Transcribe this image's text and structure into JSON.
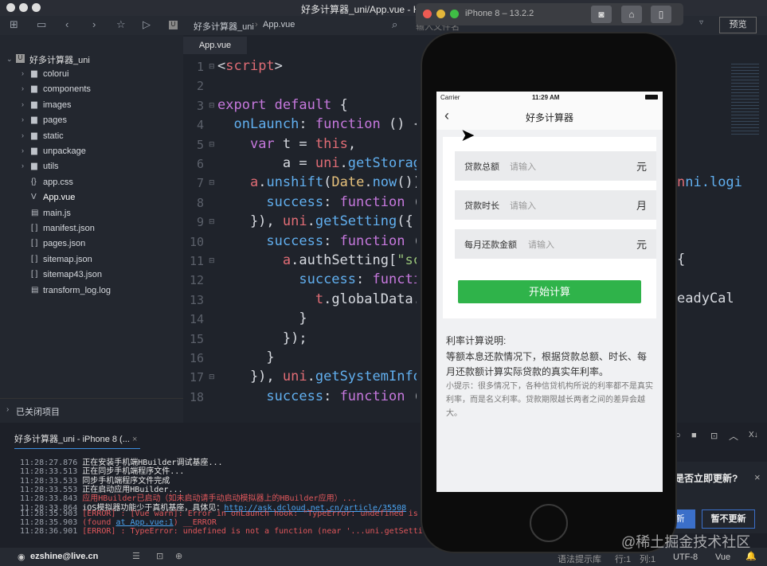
{
  "window": {
    "title": "好多计算器_uni/App.vue - HB"
  },
  "toolbar": {
    "breadcrumb": [
      "好多计算器_uni",
      "App.vue"
    ],
    "file_search_placeholder": "输入文件名",
    "preview_label": "预览"
  },
  "sidebar": {
    "project": "好多计算器_uni",
    "items": [
      {
        "label": "colorui",
        "type": "folder"
      },
      {
        "label": "components",
        "type": "folder"
      },
      {
        "label": "images",
        "type": "folder"
      },
      {
        "label": "pages",
        "type": "folder"
      },
      {
        "label": "static",
        "type": "folder"
      },
      {
        "label": "unpackage",
        "type": "folder"
      },
      {
        "label": "utils",
        "type": "folder"
      },
      {
        "label": "app.css",
        "type": "css"
      },
      {
        "label": "App.vue",
        "type": "vue"
      },
      {
        "label": "main.js",
        "type": "file"
      },
      {
        "label": "manifest.json",
        "type": "json"
      },
      {
        "label": "pages.json",
        "type": "json"
      },
      {
        "label": "sitemap.json",
        "type": "json"
      },
      {
        "label": "sitemap43.json",
        "type": "json"
      },
      {
        "label": "transform_log.log",
        "type": "file"
      }
    ],
    "closed_projects": "已关闭项目"
  },
  "editor": {
    "tab": "App.vue",
    "line_numbers": [
      "1",
      "2",
      "3",
      "4",
      "5",
      "6",
      "7",
      "8",
      "9",
      "10",
      "11",
      "12",
      "13",
      "14",
      "15",
      "16",
      "17",
      "18"
    ],
    "right_fragments": [
      "ni.logi",
      "{",
      "eadyCal"
    ]
  },
  "console": {
    "tab": "好多计算器_uni - iPhone 8 (...",
    "lines": [
      {
        "time": "11:28:27.876",
        "text": "正在安装手机端HBuilder调试基座...",
        "level": "info"
      },
      {
        "time": "11:28:33.513",
        "text": "正在同步手机端程序文件...",
        "level": "info"
      },
      {
        "time": "11:28:33.533",
        "text": "同步手机端程序文件完成",
        "level": "info"
      },
      {
        "time": "11:28:33.553",
        "text": "正在启动应用HBuilder...",
        "level": "info"
      },
      {
        "time": "11:28:33.843",
        "text": "应用HBuilder已启动（如未启动请手动启动模拟器上的HBuilder应用）...",
        "level": "error"
      },
      {
        "time": "11:28:33.864",
        "text": "iOS模拟器功能少于真机基座，具体见：",
        "link": "http://ask.dcloud.net.cn/article/35508",
        "level": "info"
      },
      {
        "time": "11:28:35.903",
        "text": "[ERROR] : [Vue warn]: Error in onLaunch hook: \"TypeError: undefined is no",
        "level": "error"
      },
      {
        "time": "11:28:35.903",
        "text": "(found ",
        "link": "at App.vue:1",
        "after": ") __ERROR",
        "level": "error"
      },
      {
        "time": "11:28:36.901",
        "text": "[ERROR] : TypeError: undefined is not a function (near '...uni.getSetting.",
        "level": "error"
      }
    ]
  },
  "update": {
    "question": "是否立即更新?",
    "confirm": "新",
    "cancel": "暂不更新"
  },
  "statusbar": {
    "user": "ezshine@live.cn",
    "syntax_hint": "语法提示库",
    "row": "行:1",
    "col": "列:1",
    "encoding": "UTF-8",
    "language": "Vue"
  },
  "watermark": "@稀土掘金技术社区",
  "simulator": {
    "title": "iPhone 8 – 13.2.2"
  },
  "phone": {
    "carrier": "Carrier",
    "time": "11:29 AM",
    "nav_title": "好多计算器",
    "fields": [
      {
        "label": "贷款总额",
        "placeholder": "请输入",
        "unit": "元"
      },
      {
        "label": "贷款时长",
        "placeholder": "请输入",
        "unit": "月"
      },
      {
        "label": "每月还款金额",
        "placeholder": "请输入",
        "unit": "元"
      }
    ],
    "button": "开始计算",
    "button_color": "#2fb34a",
    "desc_title": "利率计算说明:",
    "desc_body": "等额本息还款情况下，根据贷款总额、时长、每月还款额计算实际贷款的真实年利率。",
    "tip": "小提示：很多情况下，各种信贷机构所说的利率都不是真实利率，而是名义利率。贷款期限越长两者之间的差异会越大。"
  }
}
